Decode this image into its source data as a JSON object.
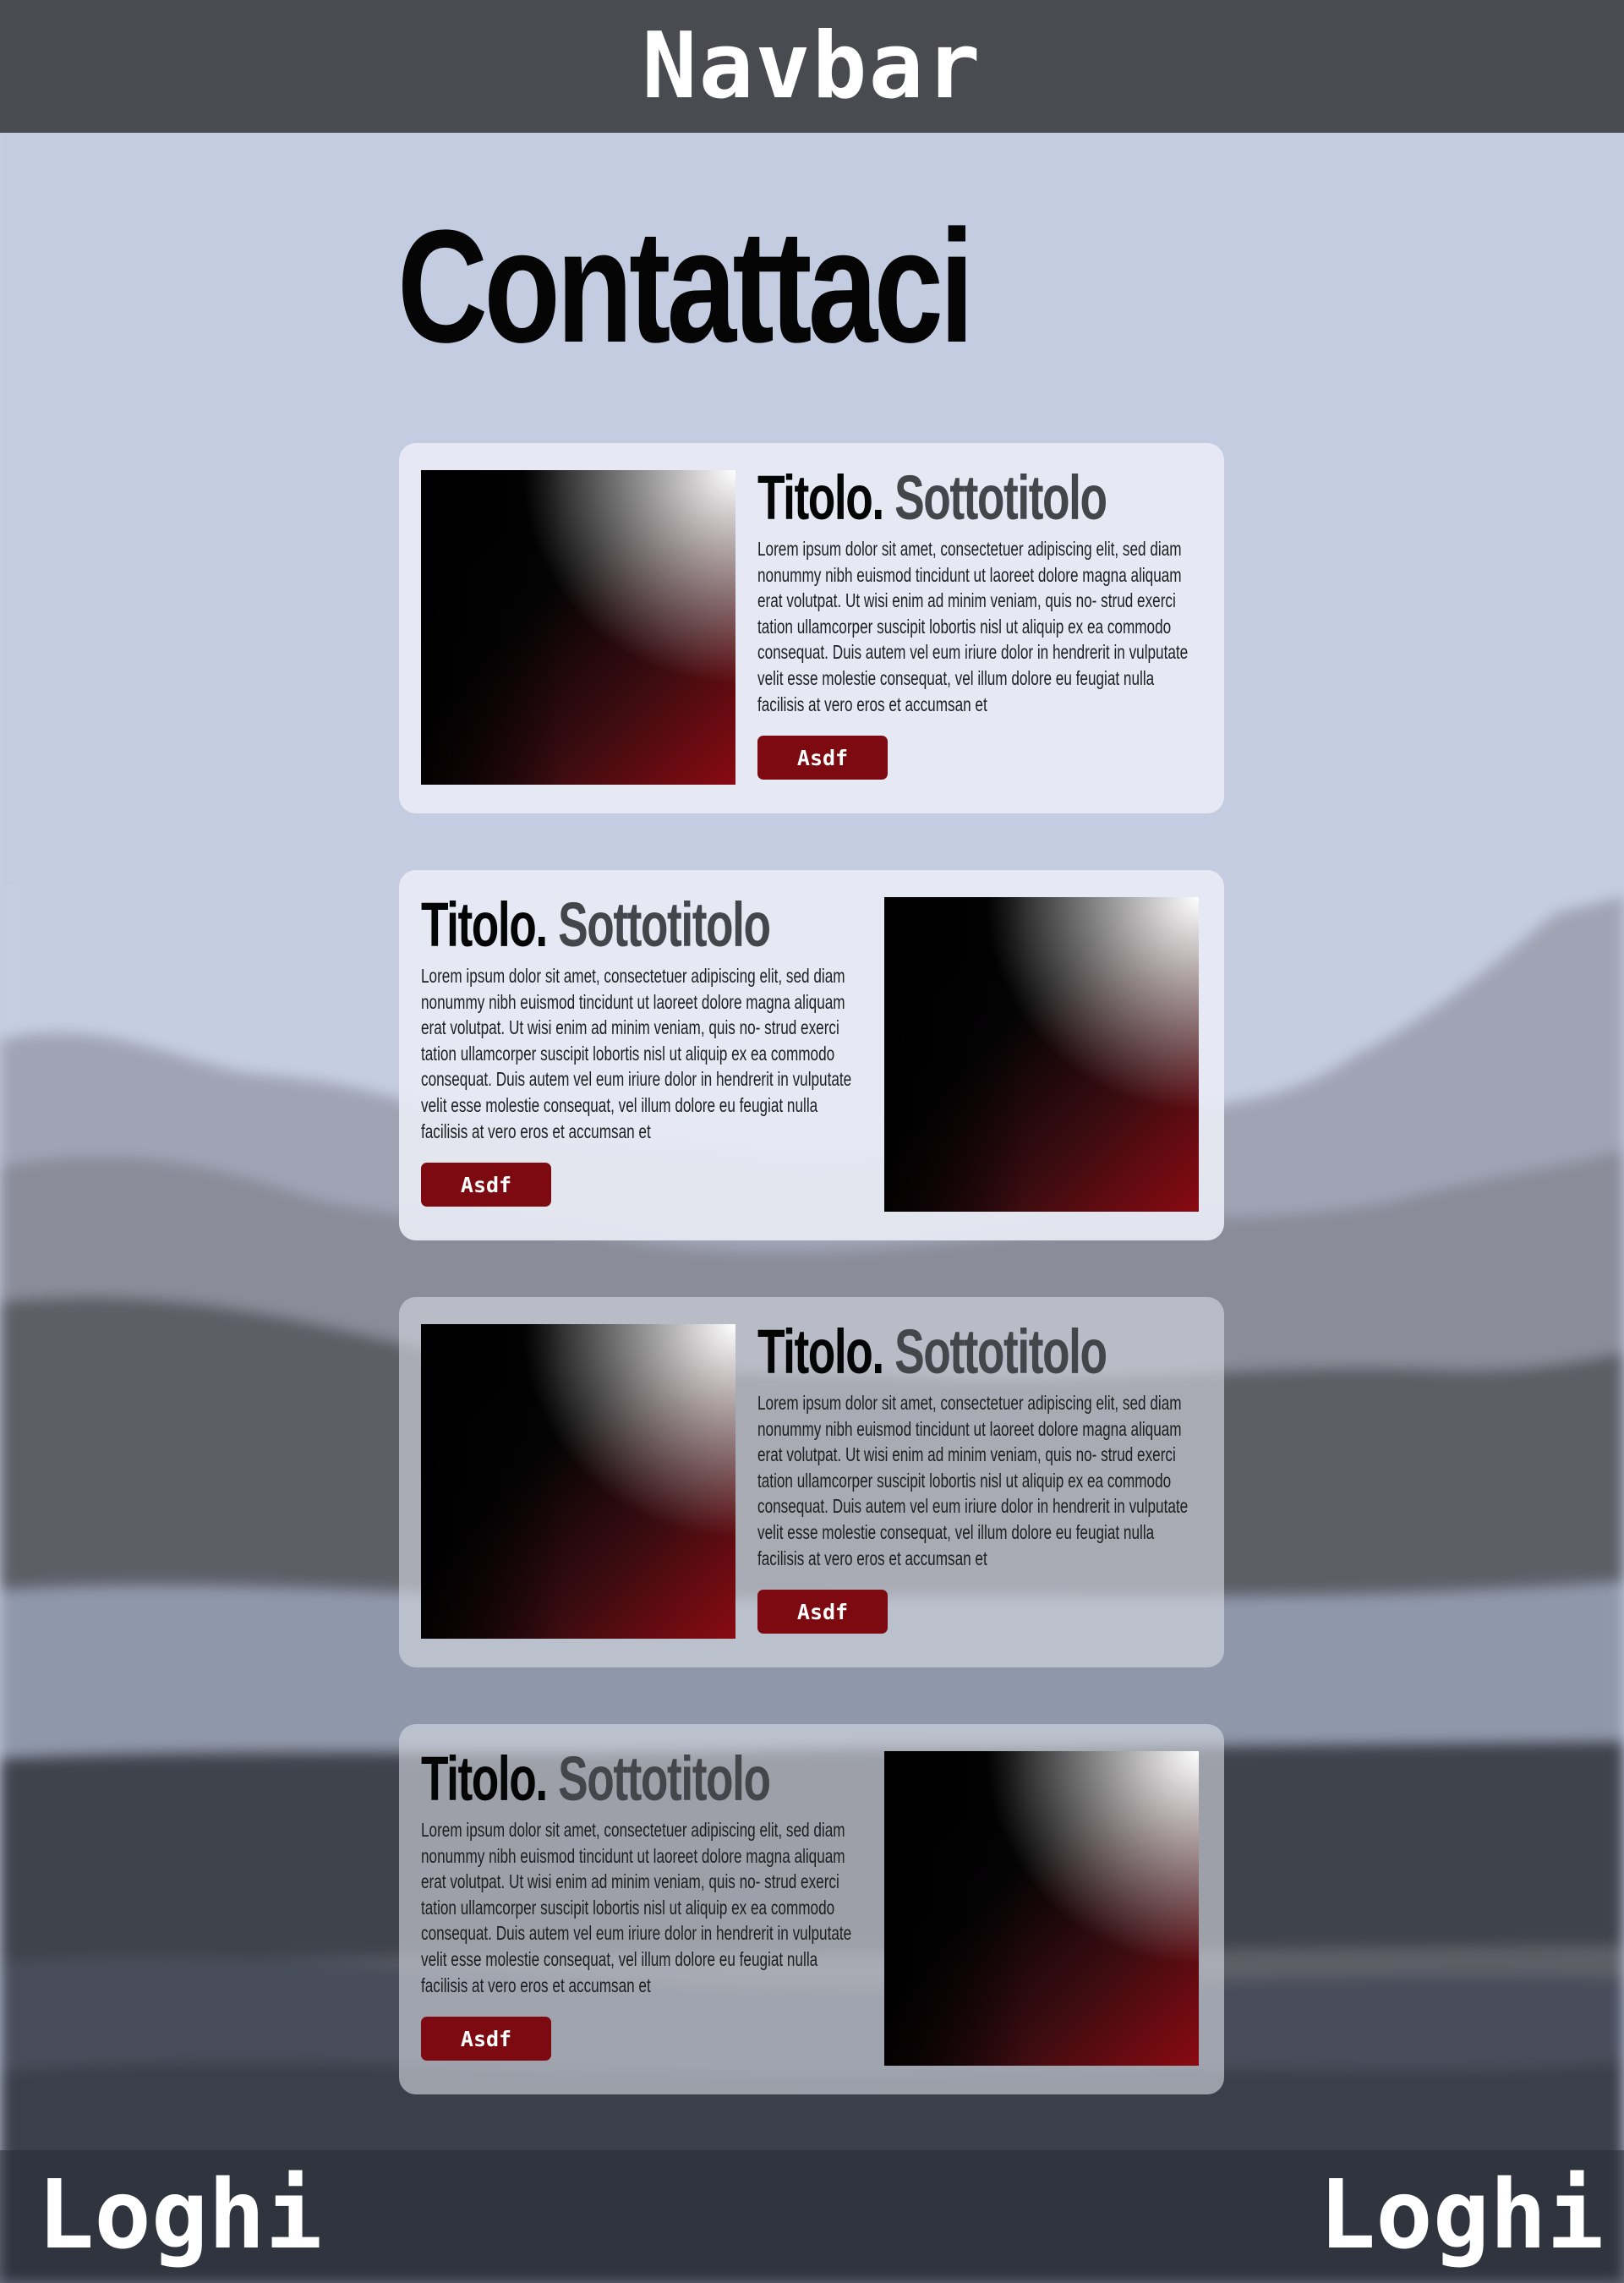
{
  "navbar": {
    "title": "Navbar"
  },
  "page": {
    "title": "Contattaci"
  },
  "cards": [
    {
      "title": "Titolo.",
      "subtitle": "Sottotitolo",
      "body": "Lorem ipsum dolor sit amet, consectetuer adipiscing elit, sed diam nonummy nibh euismod tincidunt ut laoreet dolore magna aliquam erat volutpat. Ut wisi enim ad minim veniam, quis no- strud exerci tation ullamcorper suscipit lobortis nisl ut aliquip ex ea commodo consequat. Duis autem vel eum iriure dolor in hendrerit in vulputate velit esse molestie consequat, vel illum dolore eu feugiat nulla facilisis at vero eros et accumsan et",
      "button_label": "Asdf"
    },
    {
      "title": "Titolo.",
      "subtitle": "Sottotitolo",
      "body": "Lorem ipsum dolor sit amet, consectetuer adipiscing elit, sed diam nonummy nibh euismod tincidunt ut laoreet dolore magna aliquam erat volutpat. Ut wisi enim ad minim veniam, quis no- strud exerci tation ullamcorper suscipit lobortis nisl ut aliquip ex ea commodo consequat. Duis autem vel eum iriure dolor in hendrerit in vulputate velit esse molestie consequat, vel illum dolore eu feugiat nulla facilisis at vero eros et accumsan et",
      "button_label": "Asdf"
    },
    {
      "title": "Titolo.",
      "subtitle": "Sottotitolo",
      "body": "Lorem ipsum dolor sit amet, consectetuer adipiscing elit, sed diam nonummy nibh euismod tincidunt ut laoreet dolore magna aliquam erat volutpat. Ut wisi enim ad minim veniam, quis no- strud exerci tation ullamcorper suscipit lobortis nisl ut aliquip ex ea commodo consequat. Duis autem vel eum iriure dolor in hendrerit in vulputate velit esse molestie consequat, vel illum dolore eu feugiat nulla facilisis at vero eros et accumsan et",
      "button_label": "Asdf"
    },
    {
      "title": "Titolo.",
      "subtitle": "Sottotitolo",
      "body": "Lorem ipsum dolor sit amet, consectetuer adipiscing elit, sed diam nonummy nibh euismod tincidunt ut laoreet dolore magna aliquam erat volutpat. Ut wisi enim ad minim veniam, quis no- strud exerci tation ullamcorper suscipit lobortis nisl ut aliquip ex ea commodo consequat. Duis autem vel eum iriure dolor in hendrerit in vulputate velit esse molestie consequat, vel illum dolore eu feugiat nulla facilisis at vero eros et accumsan et",
      "button_label": "Asdf"
    }
  ],
  "footer": {
    "logo_left": "Loghi",
    "logo_right": "Loghi"
  },
  "colors": {
    "navbar_bg": "#4a4b50",
    "page_bg_sky": "#c5cde2",
    "button_bg": "#7c0a10",
    "title_text": "#050505",
    "subtitle_text": "#45464c"
  }
}
